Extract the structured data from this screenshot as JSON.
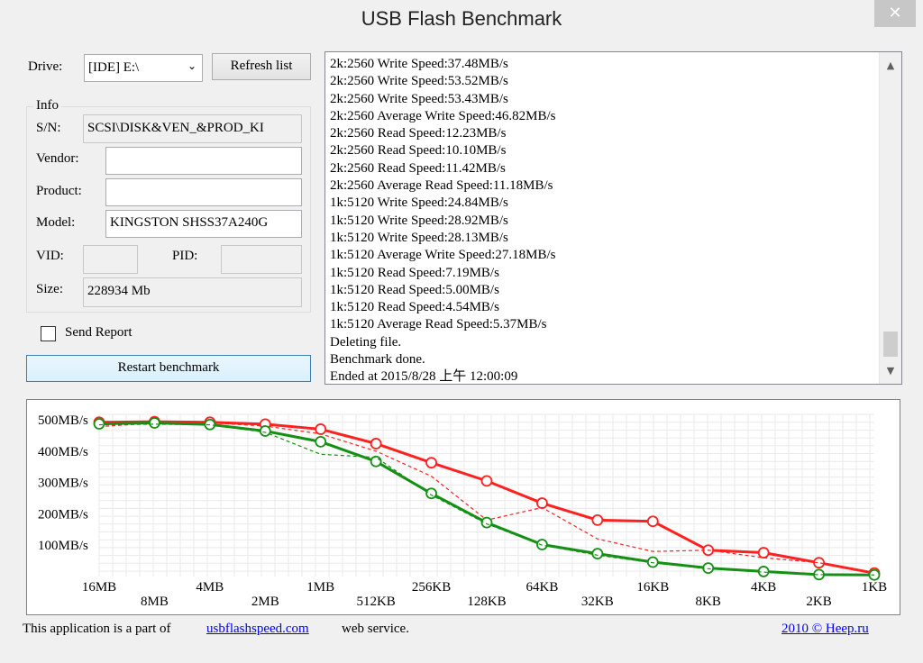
{
  "window": {
    "title": "USB Flash Benchmark",
    "close_glyph": "✕"
  },
  "drive": {
    "label": "Drive:",
    "value": "[IDE] E:\\",
    "refresh_label": "Refresh list"
  },
  "info": {
    "group_label": "Info",
    "sn_label": "S/N:",
    "sn_value": "SCSI\\DISK&VEN_&PROD_KI",
    "vendor_label": "Vendor:",
    "vendor_value": "",
    "product_label": "Product:",
    "product_value": "",
    "model_label": "Model:",
    "model_value": "KINGSTON SHSS37A240G",
    "vid_label": "VID:",
    "vid_value": "",
    "pid_label": "PID:",
    "pid_value": "",
    "size_label": "Size:",
    "size_value": "228934 Mb"
  },
  "send_report": {
    "label": "Send Report",
    "checked": false
  },
  "restart_label": "Restart benchmark",
  "log": [
    "2k:2560 Write Speed:37.48MB/s",
    "2k:2560 Write Speed:53.52MB/s",
    "2k:2560 Write Speed:53.43MB/s",
    "2k:2560 Average Write Speed:46.82MB/s",
    "2k:2560 Read Speed:12.23MB/s",
    "2k:2560 Read Speed:10.10MB/s",
    "2k:2560 Read Speed:11.42MB/s",
    "2k:2560 Average Read Speed:11.18MB/s",
    "1k:5120 Write Speed:24.84MB/s",
    "1k:5120 Write Speed:28.92MB/s",
    "1k:5120 Write Speed:28.13MB/s",
    "1k:5120 Average Write Speed:27.18MB/s",
    "1k:5120 Read Speed:7.19MB/s",
    "1k:5120 Read Speed:5.00MB/s",
    "1k:5120 Read Speed:4.54MB/s",
    "1k:5120 Average Read Speed:5.37MB/s",
    "Deleting file.",
    "Benchmark done.",
    "Ended at 2015/8/28 上午 12:00:09"
  ],
  "scroll_up_glyph": "▲",
  "scroll_down_glyph": "▼",
  "chart_data": {
    "type": "line",
    "categories": [
      "16MB",
      "8MB",
      "4MB",
      "2MB",
      "1MB",
      "512KB",
      "256KB",
      "128KB",
      "64KB",
      "32KB",
      "16KB",
      "8KB",
      "4KB",
      "2KB",
      "1KB"
    ],
    "ylim": [
      0,
      500
    ],
    "ytick_values": [
      500,
      400,
      300,
      200,
      100
    ],
    "ytick_labels": [
      "500MB/s",
      "400MB/s",
      "300MB/s",
      "200MB/s",
      "100MB/s"
    ],
    "grid": true,
    "series": [
      {
        "role": "read-average",
        "color": "#ff2020",
        "style": "solid",
        "markers": true,
        "values": [
          492,
          494,
          492,
          486,
          470,
          424,
          363,
          305,
          234,
          180,
          176,
          84,
          76,
          44,
          11
        ]
      },
      {
        "role": "read-run",
        "color": "#ff2020",
        "style": "dashed",
        "markers": false,
        "values": [
          478,
          490,
          490,
          480,
          455,
          400,
          320,
          180,
          220,
          120,
          80,
          84,
          60,
          44,
          11
        ]
      },
      {
        "role": "write-average",
        "color": "#159015",
        "style": "solid",
        "markers": true,
        "values": [
          487,
          490,
          485,
          464,
          430,
          367,
          265,
          172,
          102,
          73,
          46,
          27,
          16,
          6,
          5
        ]
      },
      {
        "role": "write-run",
        "color": "#159015",
        "style": "dashed",
        "markers": false,
        "values": [
          484,
          486,
          484,
          460,
          390,
          380,
          260,
          168,
          100,
          68,
          44,
          25,
          14,
          6,
          5
        ]
      }
    ]
  },
  "footer": {
    "text_before": "This application is a part of",
    "link": "usbflashspeed.com",
    "text_after": "web service.",
    "right_link": "2010 © Heep.ru"
  }
}
